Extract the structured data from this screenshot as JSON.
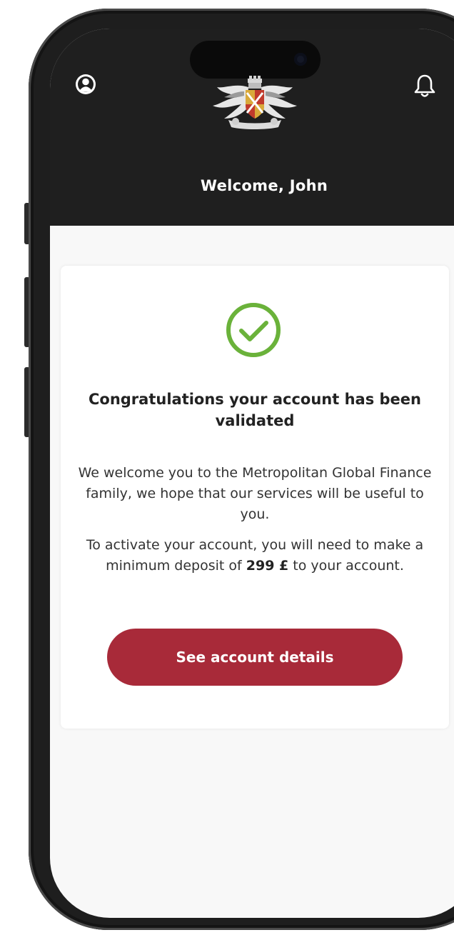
{
  "header": {
    "welcome_text": "Welcome, John",
    "profile_icon": "user-circle-icon",
    "notification_icon": "bell-icon",
    "logo": "royal-crest-logo"
  },
  "card": {
    "status_icon": "check-circle-icon",
    "title": "Congratulations your account has been validated",
    "welcome_message": "We welcome you to the Metropolitan Global Finance family, we hope that our services will be useful to you.",
    "activation_prefix": "To activate your account, you will need to make a minimum deposit of",
    "deposit_amount": "299 £",
    "activation_suffix": "to your account.",
    "button_label": "See account details"
  },
  "colors": {
    "header_background": "#1f1f1f",
    "accent": "#a82a39",
    "success": "#6ab23a",
    "screen_background": "#f8f8f8"
  }
}
